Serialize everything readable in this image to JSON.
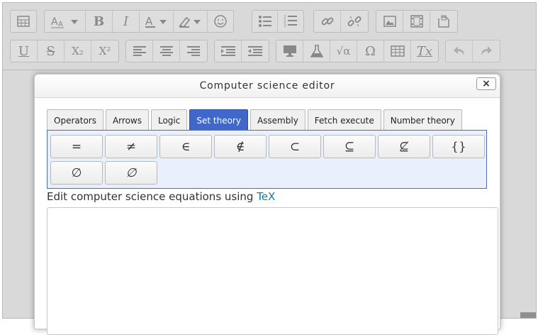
{
  "toolbar": {
    "row1": [
      [
        {
          "icon": "table-icon"
        }
      ],
      [
        {
          "icon": "font-size-icon",
          "dropdown": true
        },
        {
          "label": "B",
          "icon": "bold-icon"
        },
        {
          "label": "I",
          "icon": "italic-icon"
        },
        {
          "icon": "text-color-icon",
          "dropdown": true
        },
        {
          "icon": "highlight-icon",
          "dropdown": true
        },
        {
          "icon": "emoticon-icon"
        }
      ],
      [
        {
          "icon": "bullet-list-icon"
        },
        {
          "icon": "numbered-list-icon"
        }
      ],
      [
        {
          "icon": "link-icon"
        },
        {
          "icon": "unlink-icon"
        }
      ],
      [
        {
          "icon": "image-icon"
        },
        {
          "icon": "media-icon"
        },
        {
          "icon": "manage-files-icon"
        }
      ]
    ],
    "row2": [
      [
        {
          "label": "U",
          "icon": "underline-icon"
        },
        {
          "label": "S",
          "icon": "strikethrough-icon"
        },
        {
          "label": "X₂",
          "icon": "subscript-icon"
        },
        {
          "label": "X²",
          "icon": "superscript-icon"
        }
      ],
      [
        {
          "icon": "align-left-icon"
        },
        {
          "icon": "align-center-icon"
        },
        {
          "icon": "align-right-icon"
        }
      ],
      [
        {
          "icon": "indent-icon"
        },
        {
          "icon": "outdent-icon"
        }
      ],
      [
        {
          "icon": "screenreader-icon"
        },
        {
          "icon": "chemistry-icon"
        },
        {
          "label": "√α",
          "icon": "equation-icon"
        },
        {
          "label": "Ω",
          "icon": "special-char-icon"
        },
        {
          "icon": "table-grid-icon"
        },
        {
          "label": "Tx",
          "icon": "clear-formatting-icon"
        }
      ],
      [
        {
          "icon": "undo-icon"
        },
        {
          "icon": "redo-icon"
        }
      ]
    ]
  },
  "dialog": {
    "title": "Computer science editor",
    "close_symbol": "×",
    "tabs": [
      "Operators",
      "Arrows",
      "Logic",
      "Set theory",
      "Assembly",
      "Fetch execute",
      "Number theory"
    ],
    "active_tab": "Set theory",
    "symbols": [
      "=",
      "≠",
      "∈",
      "∉",
      "⊂",
      "⊆",
      "⊈",
      "{}",
      "∅",
      "∅"
    ],
    "edit_label_prefix": "Edit computer science equations using ",
    "edit_label_link": "TeX",
    "textarea_value": ""
  }
}
